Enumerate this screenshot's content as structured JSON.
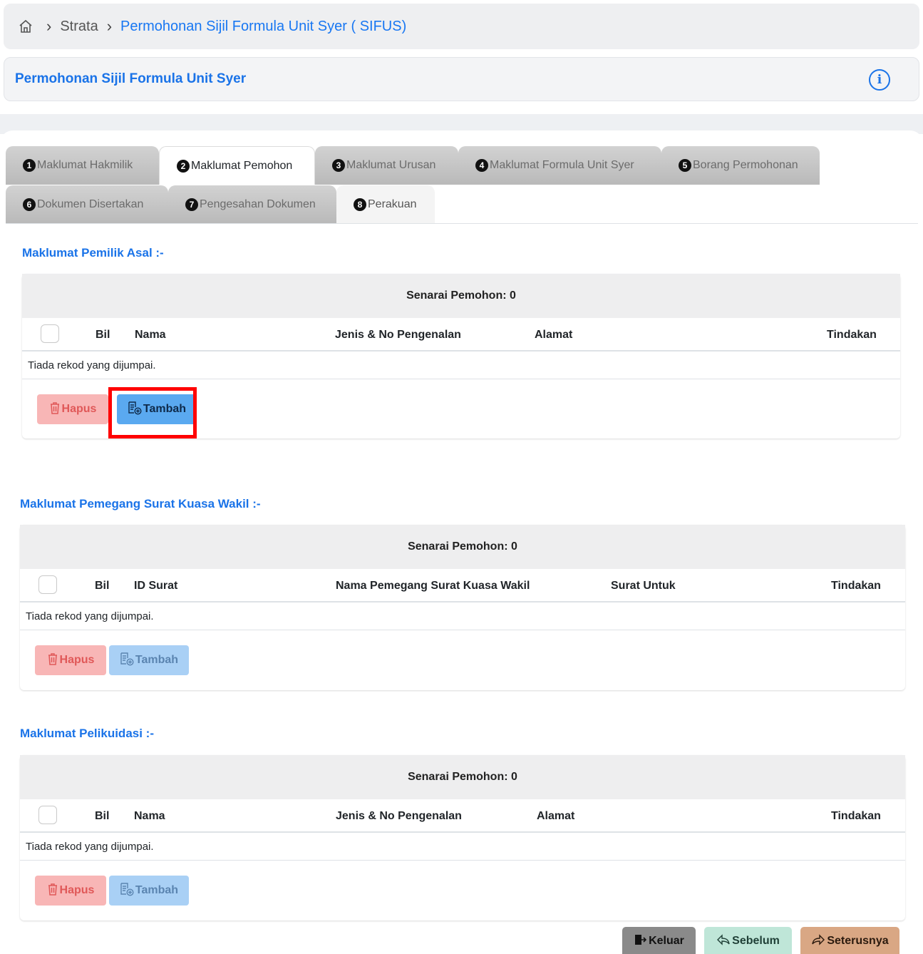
{
  "breadcrumb": {
    "items": [
      "Strata",
      "Permohonan Sijil Formula Unit Syer ( SIFUS)"
    ]
  },
  "header": {
    "title": "Permohonan Sijil Formula Unit Syer"
  },
  "tabs": [
    {
      "num": "1",
      "label": "Maklumat Hakmilik"
    },
    {
      "num": "2",
      "label": "Maklumat Pemohon"
    },
    {
      "num": "3",
      "label": "Maklumat Urusan"
    },
    {
      "num": "4",
      "label": "Maklumat Formula Unit Syer"
    },
    {
      "num": "5",
      "label": "Borang Permohonan"
    },
    {
      "num": "6",
      "label": "Dokumen Disertakan"
    },
    {
      "num": "7",
      "label": "Pengesahan Dokumen"
    },
    {
      "num": "8",
      "label": "Perakuan"
    }
  ],
  "sections": [
    {
      "title": "Maklumat Pemilik Asal :-",
      "caption": "Senarai Pemohon: 0",
      "columns": [
        "Bil",
        "Nama",
        "Jenis & No Pengenalan",
        "Alamat",
        "Tindakan"
      ],
      "empty": "Tiada rekod yang dijumpai.",
      "buttons": {
        "delete": "Hapus",
        "add": "Tambah"
      }
    },
    {
      "title": "Maklumat Pemegang Surat Kuasa Wakil :-",
      "caption": "Senarai Pemohon: 0",
      "columns": [
        "Bil",
        "ID Surat",
        "Nama Pemegang Surat Kuasa Wakil",
        "Surat Untuk",
        "Tindakan"
      ],
      "empty": "Tiada rekod yang dijumpai.",
      "buttons": {
        "delete": "Hapus",
        "add": "Tambah"
      }
    },
    {
      "title": "Maklumat Pelikuidasi :-",
      "caption": "Senarai Pemohon: 0",
      "columns": [
        "Bil",
        "Nama",
        "Jenis & No Pengenalan",
        "Alamat",
        "Tindakan"
      ],
      "empty": "Tiada rekod yang dijumpai.",
      "buttons": {
        "delete": "Hapus",
        "add": "Tambah"
      }
    }
  ],
  "footer": {
    "exit": "Keluar",
    "prev": "Sebelum",
    "next": "Seterusnya"
  },
  "colors": {
    "accent": "#1a73e8",
    "highlight": "#ff0000"
  }
}
